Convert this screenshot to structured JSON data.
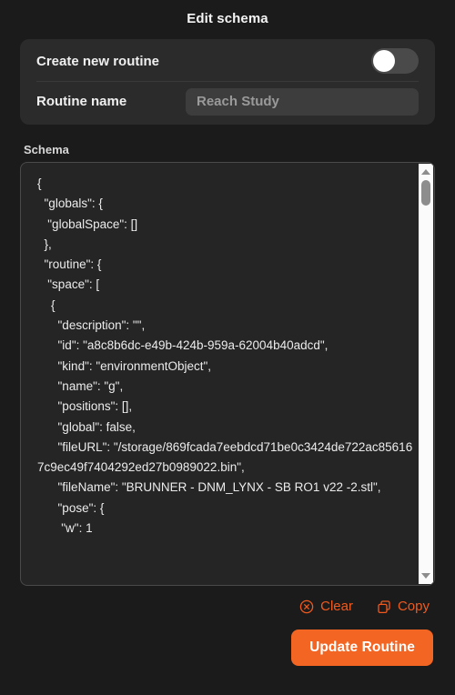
{
  "modal": {
    "title": "Edit schema"
  },
  "settings": {
    "create_new_routine": {
      "label": "Create new routine",
      "toggle_state": "off"
    },
    "routine_name": {
      "label": "Routine name",
      "value": "",
      "placeholder": "Reach Study"
    }
  },
  "schema": {
    "label": "Schema",
    "content": "{\n  \"globals\": {\n   \"globalSpace\": []\n  },\n  \"routine\": {\n   \"space\": [\n    {\n      \"description\": \"\",\n      \"id\": \"a8c8b6dc-e49b-424b-959a-62004b40adcd\",\n      \"kind\": \"environmentObject\",\n      \"name\": \"g\",\n      \"positions\": [],\n      \"global\": false,\n      \"fileURL\": \"/storage/869fcada7eebdcd71be0c3424de722ac856167c9ec49f7404292ed27b0989022.bin\",\n      \"fileName\": \"BRUNNER - DNM_LYNX - SB RO1 v22 -2.stl\",\n      \"pose\": {\n       \"w\": 1",
    "scrollbar": {
      "up_arrow": "scroll-up",
      "down_arrow": "scroll-down"
    }
  },
  "actions": {
    "clear_label": "Clear",
    "copy_label": "Copy"
  },
  "footer": {
    "update_label": "Update Routine"
  },
  "colors": {
    "accent": "#f26522",
    "link": "#f05a1e",
    "background": "#1b1b1b",
    "card": "#2b2b2b",
    "field": "#3d3d3d",
    "editor": "#252525"
  }
}
